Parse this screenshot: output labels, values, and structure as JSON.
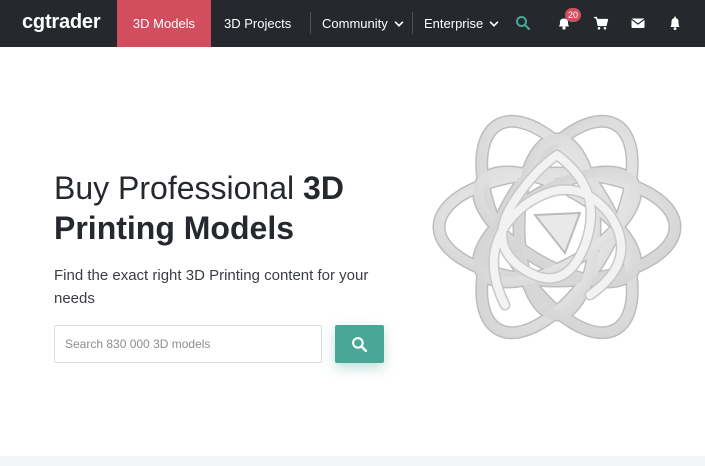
{
  "header": {
    "logo": "cgtrader",
    "nav": [
      {
        "label": "3D Models",
        "active": true
      },
      {
        "label": "3D Projects",
        "active": false
      },
      {
        "label": "Community",
        "active": false,
        "dropdown": true
      },
      {
        "label": "Enterprise",
        "active": false,
        "dropdown": true
      }
    ],
    "icons": [
      "search-icon",
      "notifications-bell-icon",
      "cart-icon",
      "mail-icon",
      "bell-icon"
    ],
    "badge_count": "20",
    "colors": {
      "bar": "#25282d",
      "active": "#d24e5f",
      "accent": "#4aa697"
    }
  },
  "hero": {
    "title_regular": "Buy Professional ",
    "title_bold": "3D Printing Models",
    "subtitle": "Find the exact right 3D Printing content for your needs",
    "search": {
      "placeholder": "Search 830 000 3D models",
      "value": ""
    },
    "search_button_icon": "search-icon",
    "image": "3d-printed-knot-sculpture"
  }
}
